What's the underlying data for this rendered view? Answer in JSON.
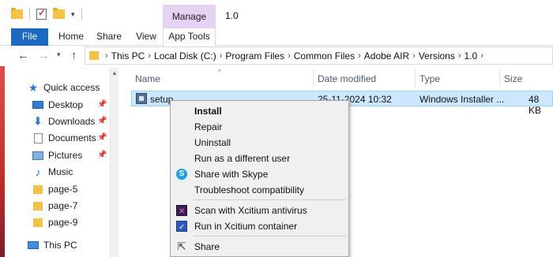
{
  "window": {
    "title": "1.0",
    "context_tab_group": "Manage"
  },
  "ribbon": {
    "tabs": [
      "File",
      "Home",
      "Share",
      "View",
      "App Tools"
    ]
  },
  "address": {
    "crumbs": [
      "This PC",
      "Local Disk (C:)",
      "Program Files",
      "Common Files",
      "Adobe AIR",
      "Versions",
      "1.0"
    ]
  },
  "nav": {
    "quick_access": "Quick access",
    "items": [
      {
        "label": "Desktop",
        "icon": "desktop-icon",
        "pinned": true
      },
      {
        "label": "Downloads",
        "icon": "download-icon",
        "pinned": true
      },
      {
        "label": "Documents",
        "icon": "documents-icon",
        "pinned": true
      },
      {
        "label": "Pictures",
        "icon": "pictures-icon",
        "pinned": true
      },
      {
        "label": "Music",
        "icon": "music-icon",
        "pinned": false
      },
      {
        "label": "page-5",
        "icon": "folder-icon",
        "pinned": false
      },
      {
        "label": "page-7",
        "icon": "folder-icon",
        "pinned": false
      },
      {
        "label": "page-9",
        "icon": "folder-icon",
        "pinned": false
      }
    ],
    "this_pc": "This PC"
  },
  "columns": {
    "name": "Name",
    "date": "Date modified",
    "type": "Type",
    "size": "Size"
  },
  "files": [
    {
      "name": "setup",
      "date": "25-11-2024 10:32",
      "type": "Windows Installer ...",
      "size": "48 KB"
    }
  ],
  "context_menu": {
    "install": "Install",
    "repair": "Repair",
    "uninstall": "Uninstall",
    "run_as": "Run as a different user",
    "skype": "Share with Skype",
    "troubleshoot": "Troubleshoot compatibility",
    "scan": "Scan with Xcitium antivirus",
    "container": "Run in Xcitium container",
    "share": "Share"
  },
  "colors": {
    "file_tab": "#1a6ac4",
    "manage_tab": "#e6d3f3",
    "selection": "#cce8ff"
  }
}
